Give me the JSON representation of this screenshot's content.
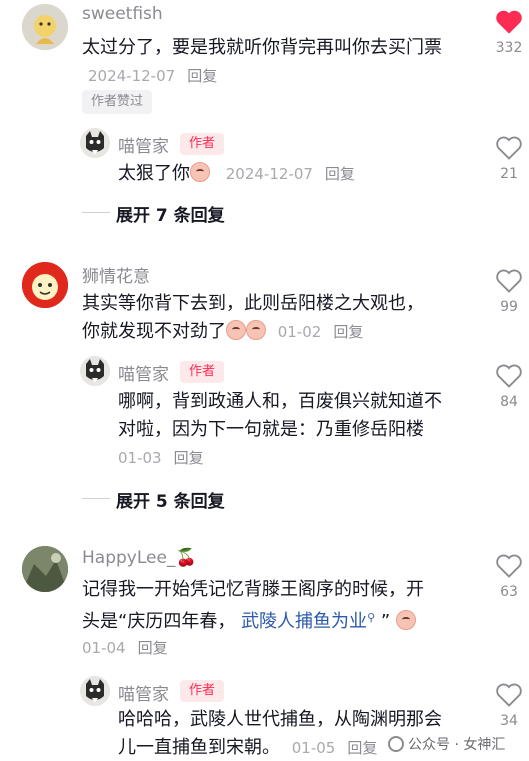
{
  "comments": [
    {
      "username": "sweetfish",
      "text": "太过分了，要是我就听你背完再叫你去买门票",
      "date": "2024-12-07",
      "reply_label": "回复",
      "liked_by_author": "作者赞过",
      "likes": "332",
      "liked": true,
      "replies": [
        {
          "username": "喵管家",
          "author_tag": "作者",
          "text": "太狠了你",
          "date": "2024-12-07",
          "reply_label": "回复",
          "likes": "21"
        }
      ],
      "expand_label": "展开 7 条回复"
    },
    {
      "username": "狮情花意",
      "text_line1": "其实等你背下去到，此则岳阳楼之大观也，",
      "text_line2": "你就发现不对劲了",
      "date": "01-02",
      "reply_label": "回复",
      "likes": "99",
      "replies": [
        {
          "username": "喵管家",
          "author_tag": "作者",
          "text_line1": "哪啊，背到政通人和，百废俱兴就知道不",
          "text_line2": "对啦，因为下一句就是：乃重修岳阳楼",
          "date": "01-03",
          "reply_label": "回复",
          "likes": "84"
        }
      ],
      "expand_label": "展开 5 条回复"
    },
    {
      "username": "HappyLee_",
      "username_emoji": "🍒",
      "text_line1": "记得我一开始凭记忆背滕王阁序的时候，开",
      "text_line2_prefix": "头是“庆历四年春，",
      "text_line2_link": "武陵人捕鱼为业",
      "text_line2_suffix": "”",
      "date": "01-04",
      "reply_label": "回复",
      "likes": "63",
      "replies": [
        {
          "username": "喵管家",
          "author_tag": "作者",
          "text_line1": "哈哈哈，武陵人世代捕鱼，从陶渊明那会",
          "text_line2": "儿一直捕鱼到宋朝。",
          "date": "01-05",
          "reply_label": "回复",
          "likes": "34"
        }
      ]
    }
  ],
  "watermark": "公众号 · 女神汇",
  "colors": {
    "accent": "#fe2c55",
    "text": "#161823",
    "muted": "#8a8b91",
    "link": "#2b5aad"
  }
}
